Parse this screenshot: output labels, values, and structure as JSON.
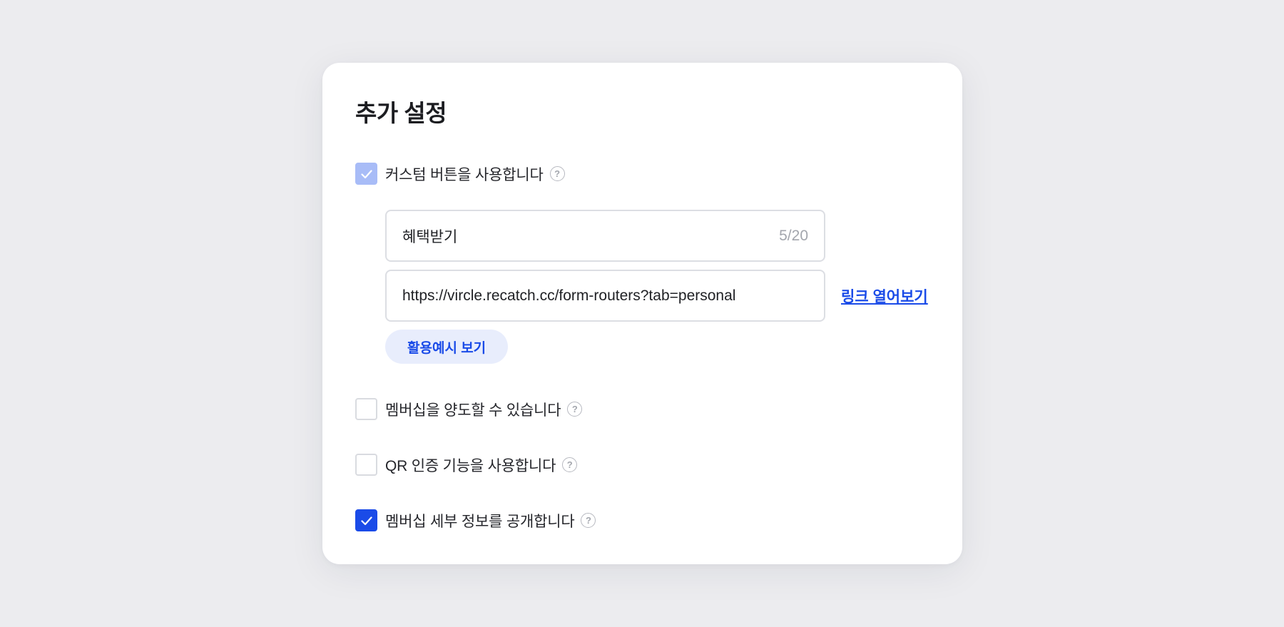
{
  "panel": {
    "title": "추가 설정"
  },
  "options": {
    "custom_button": {
      "label": "커스텀 버튼을 사용합니다",
      "checked": true
    },
    "membership_transfer": {
      "label": "멤버십을 양도할 수 있습니다",
      "checked": false
    },
    "qr_auth": {
      "label": "QR 인증 기능을 사용합니다",
      "checked": false
    },
    "membership_details": {
      "label": "멤버십 세부 정보를 공개합니다",
      "checked": true
    }
  },
  "custom_button": {
    "name_value": "혜택받기",
    "name_counter": "5/20",
    "url_value": "https://vircle.recatch.cc/form-routers?tab=personal",
    "open_link_label": "링크 열어보기",
    "example_button_label": "활용예시 보기"
  },
  "icons": {
    "help": "question-circle-icon",
    "check": "checkmark-icon"
  },
  "colors": {
    "accent": "#1a4be8",
    "accent_soft": "#a8bcf7",
    "pill_bg": "#e8edfc",
    "background": "#ececef"
  }
}
